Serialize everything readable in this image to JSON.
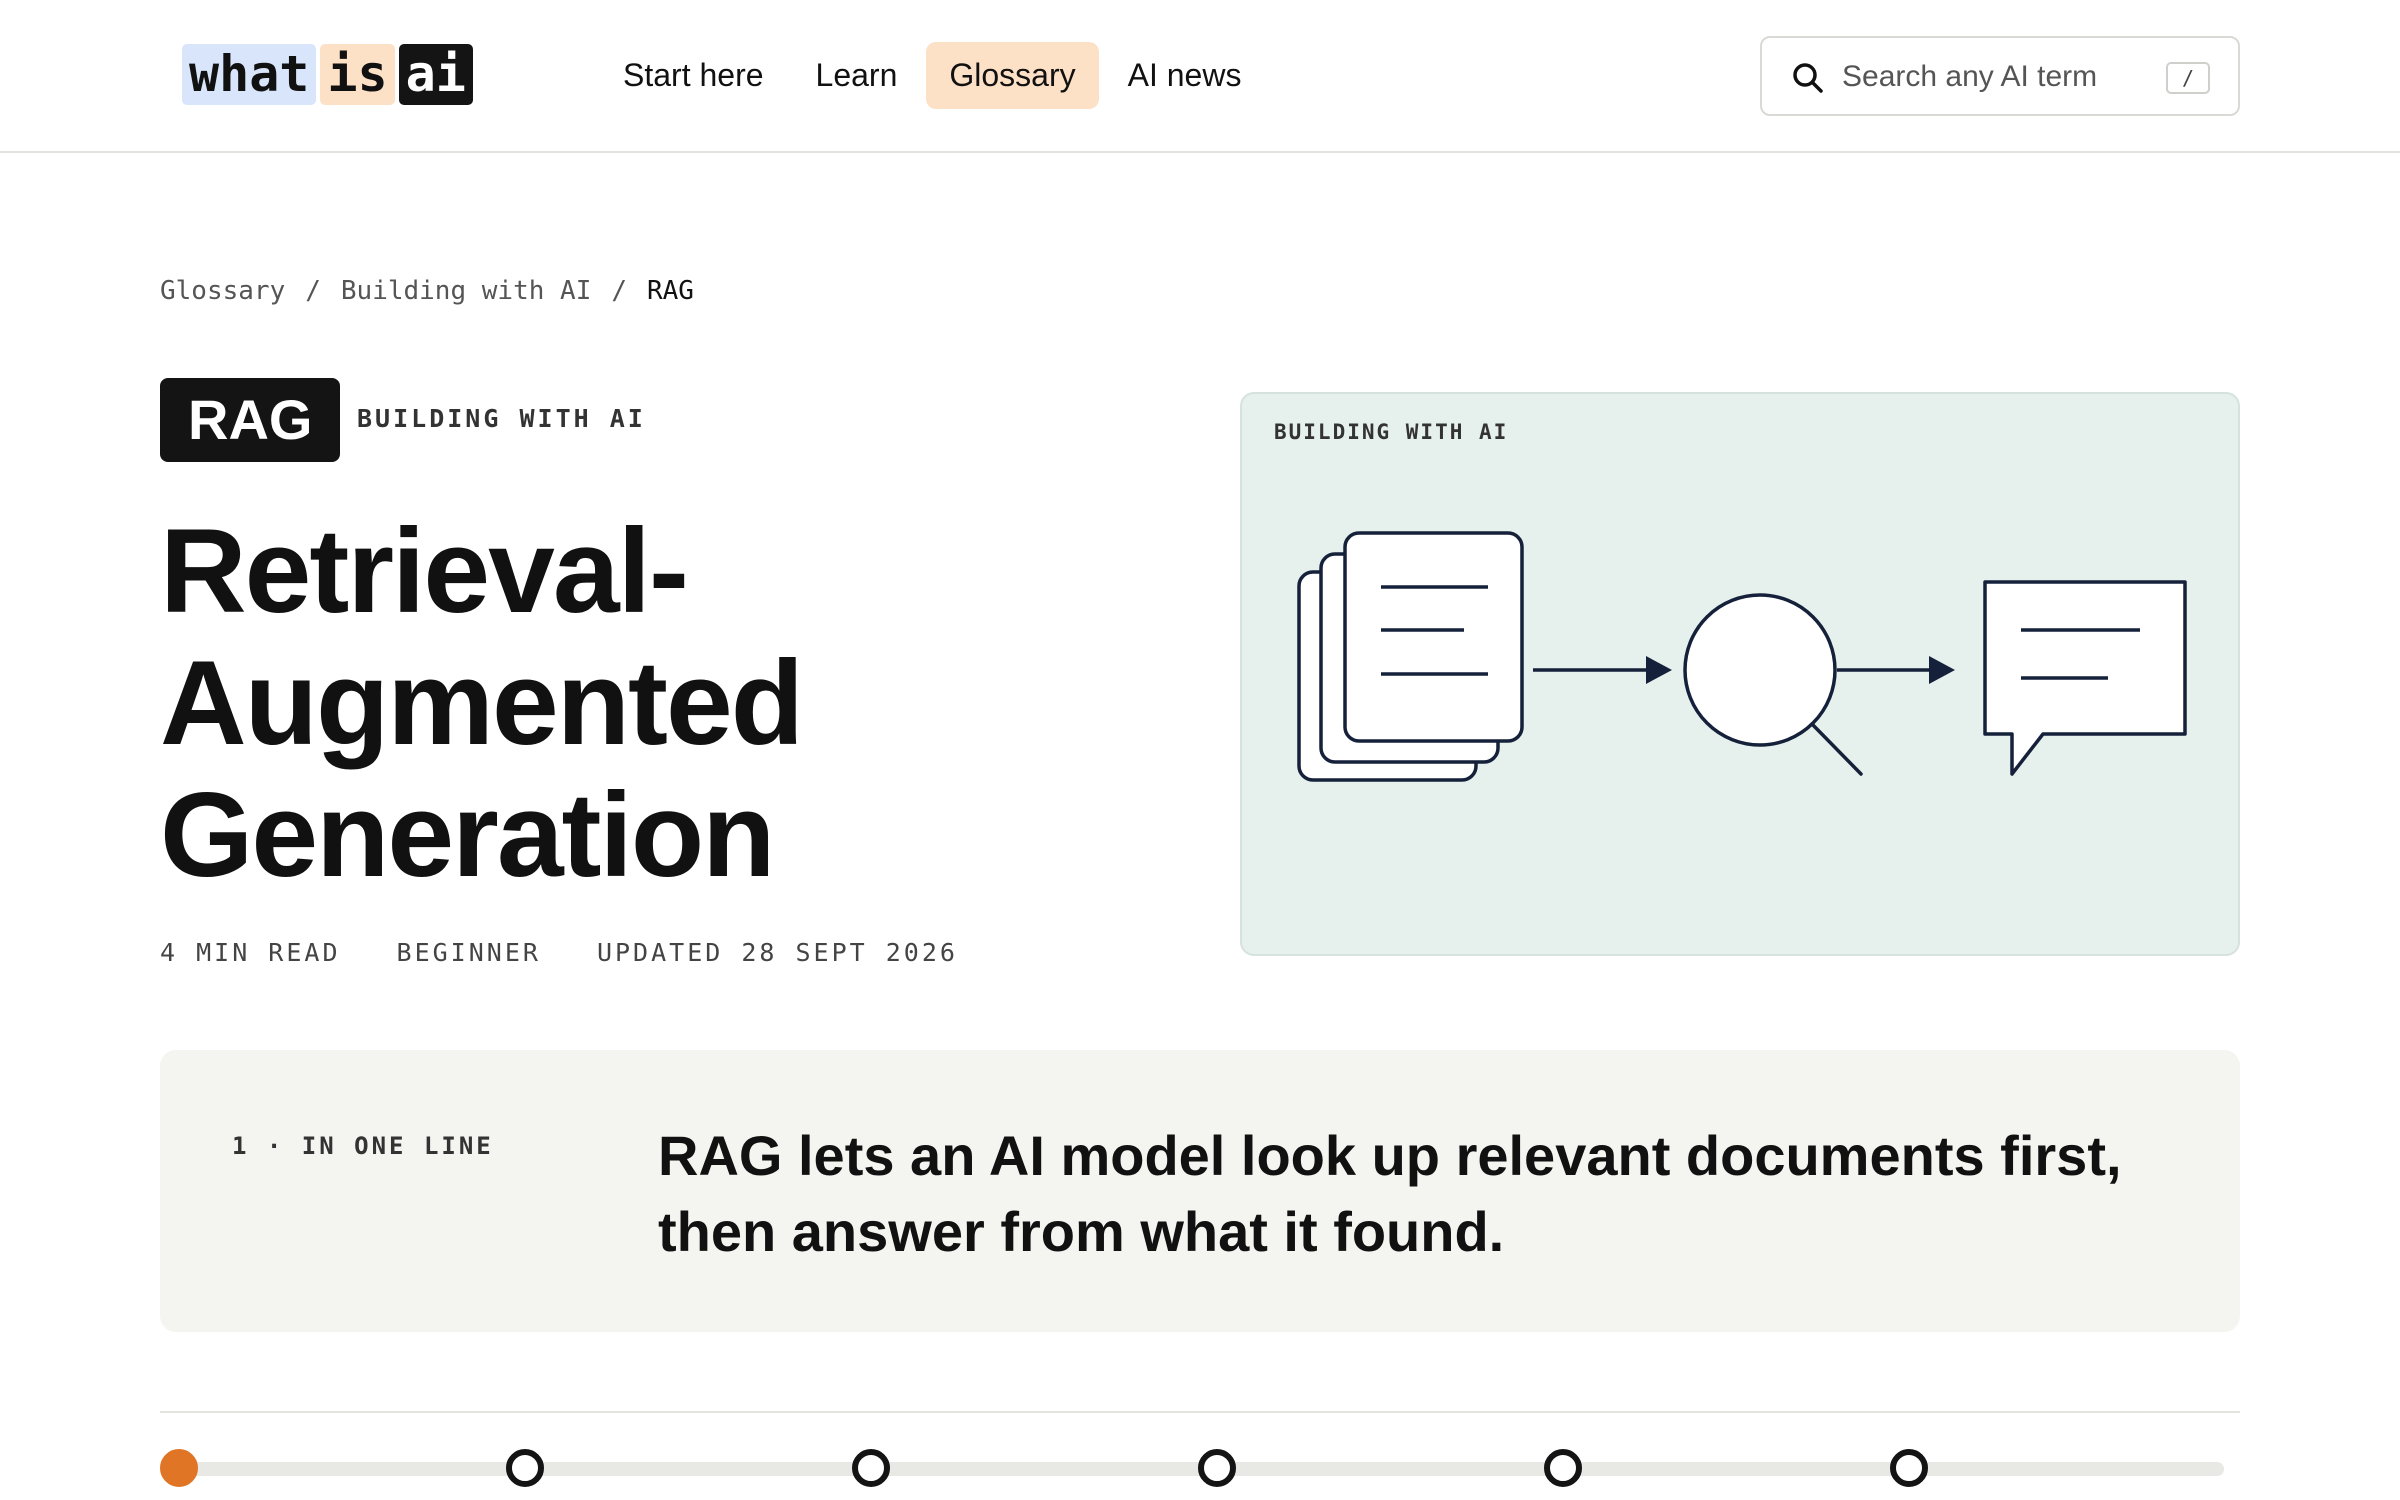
{
  "brand": {
    "logo_words": [
      "what",
      "is",
      "ai"
    ]
  },
  "nav": {
    "items": [
      {
        "label": "Start here",
        "active": false
      },
      {
        "label": "Learn",
        "active": false
      },
      {
        "label": "Glossary",
        "active": true
      },
      {
        "label": "AI news",
        "active": false
      }
    ]
  },
  "search": {
    "placeholder": "Search any AI term",
    "shortcut": "/"
  },
  "breadcrumb": {
    "items": [
      "Glossary",
      "Building with AI",
      "RAG"
    ],
    "separator": "/"
  },
  "term": {
    "badge": "RAG",
    "category": "BUILDING WITH AI",
    "title_lines": [
      "Retrieval-",
      "Augmented",
      "Generation"
    ],
    "meta": [
      "4 MIN READ",
      "BEGINNER",
      "UPDATED 28 SEPT 2026"
    ]
  },
  "illustration": {
    "label": "BUILDING WITH AI",
    "icons": [
      "documents-icon",
      "magnifier-icon",
      "chat-bubble-icon"
    ]
  },
  "one_line": {
    "label": "1 · IN ONE LINE",
    "text_lines": [
      "RAG lets an AI model look up relevant documents first,",
      "then answer from what it found."
    ]
  },
  "progress": {
    "steps": 6,
    "current": 1
  },
  "colors": {
    "accent": "#e07625",
    "nav_active": "#fde1c6",
    "logo_blue": "#d8e5fb",
    "panel_bg": "#e6f0ed",
    "card_bg": "#f4f4f0",
    "ink": "#141414"
  }
}
